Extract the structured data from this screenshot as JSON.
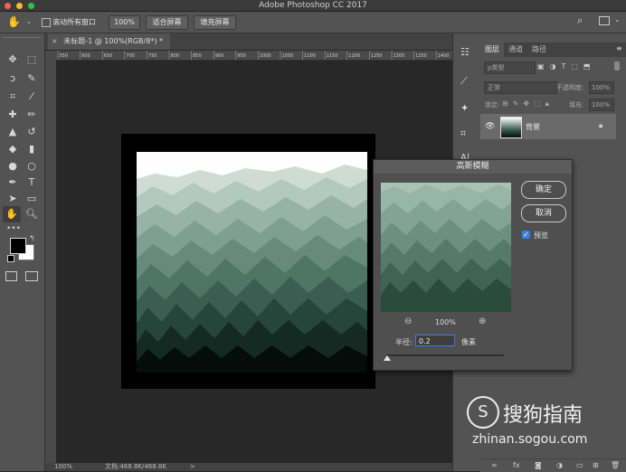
{
  "app": {
    "window_title": "Adobe Photoshop CC 2017"
  },
  "options_bar": {
    "scroll_all_label": "滚动所有窗口",
    "zoom_100_label": "100%",
    "fit_screen_label": "适合屏幕",
    "fill_screen_label": "填充屏幕"
  },
  "document": {
    "tab_label": "未标题-1 @ 100%(RGB/8*) *",
    "ruler_marks": [
      "550",
      "600",
      "650",
      "700",
      "750",
      "800",
      "850",
      "900",
      "950",
      "1000",
      "1050",
      "1100",
      "1150",
      "1200",
      "1250",
      "1300",
      "1350",
      "1400"
    ]
  },
  "status_bar": {
    "zoom": "100%",
    "doc_info": "文档:468.8K/468.8K"
  },
  "layers_panel": {
    "tabs": [
      "图层",
      "通道",
      "路径"
    ],
    "filter_label": "ρ类型",
    "blend_mode": "正常",
    "opacity_label": "不透明度:",
    "opacity_value": "100%",
    "lock_label": "锁定:",
    "fill_label": "填充:",
    "fill_value": "100%",
    "layer_name": "背景"
  },
  "gaussian_blur": {
    "title": "高斯模糊",
    "ok_label": "确定",
    "cancel_label": "取消",
    "preview_label": "预览",
    "preview_checked": true,
    "zoom_value": "100%",
    "radius_label": "半径:",
    "radius_value": "0.2",
    "unit_label": "像素"
  },
  "watermark": {
    "brand": "搜狗指南",
    "url": "zhinan.sogou.com"
  },
  "colors": {
    "accent_green": "#5e8f7c",
    "dark_green": "#1f3a2f",
    "checkbox_blue": "#3d7fd9"
  }
}
